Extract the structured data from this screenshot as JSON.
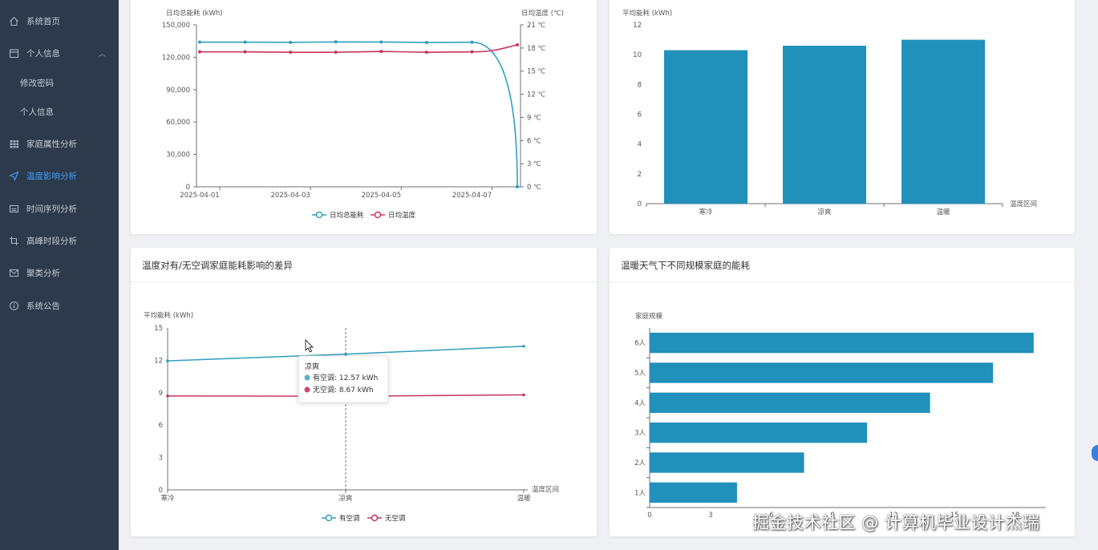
{
  "sidebar": {
    "items": [
      {
        "label": "系统首页",
        "icon": "home-icon"
      },
      {
        "label": "个人信息",
        "icon": "calendar-icon"
      },
      {
        "label": "修改密码"
      },
      {
        "label": "个人信息"
      },
      {
        "label": "家庭属性分析",
        "icon": "grid-icon"
      },
      {
        "label": "温度影响分析",
        "icon": "send-icon"
      },
      {
        "label": "时间序列分析",
        "icon": "keyboard-icon"
      },
      {
        "label": "高峰时段分析",
        "icon": "crop-icon"
      },
      {
        "label": "聚类分析",
        "icon": "mail-icon"
      },
      {
        "label": "系统公告",
        "icon": "info-icon"
      }
    ],
    "active": "温度影响分析"
  },
  "chart_data": [
    {
      "type": "line",
      "x": [
        "2025-04-01",
        "2025-04-02",
        "2025-04-03",
        "2025-04-04",
        "2025-04-05",
        "2025-04-06",
        "2025-04-07",
        "2025-04-08"
      ],
      "xticks": [
        "2025-04-01",
        "2025-04-03",
        "2025-04-05",
        "2025-04-07"
      ],
      "series": [
        {
          "name": "日均总能耗",
          "axis": "left",
          "color": "#2f9fbd",
          "values": [
            134000,
            134000,
            133800,
            134200,
            134100,
            133700,
            133900,
            0
          ]
        },
        {
          "name": "日均温度",
          "axis": "right",
          "color": "#c7365f",
          "values": [
            17.5,
            17.5,
            17.45,
            17.45,
            17.55,
            17.45,
            17.5,
            18.4
          ]
        }
      ],
      "ylabel_left": "日均总能耗 (kWh)",
      "ylabel_right": "日均温度 (℃)",
      "yticks_left": [
        "0",
        "30,000",
        "60,000",
        "90,000",
        "120,000",
        "150,000"
      ],
      "yticks_right": [
        "0 ℃",
        "3 ℃",
        "6 ℃",
        "9 ℃",
        "12 ℃",
        "15 ℃",
        "18 ℃",
        "21 ℃"
      ],
      "ylim_left": [
        0,
        150000
      ],
      "ylim_right": [
        0,
        21
      ],
      "legend_position": "bottom"
    },
    {
      "type": "bar",
      "categories": [
        "寒冷",
        "凉爽",
        "温暖"
      ],
      "values": [
        10.3,
        10.6,
        11.0
      ],
      "color": "#2190bb",
      "ylabel": "平均能耗 (kWh)",
      "xlabel": "温度区间",
      "yticks": [
        "0",
        "2",
        "4",
        "6",
        "8",
        "10",
        "12"
      ],
      "ylim": [
        0,
        12
      ]
    },
    {
      "type": "line",
      "title": "温度对有/无空调家庭能耗影响的差异",
      "categories": [
        "寒冷",
        "凉爽",
        "温暖"
      ],
      "series": [
        {
          "name": "有空调",
          "color": "#2f9fbd",
          "values": [
            11.95,
            12.57,
            13.3
          ]
        },
        {
          "name": "无空调",
          "color": "#c7365f",
          "values": [
            8.7,
            8.67,
            8.8
          ]
        }
      ],
      "ylabel": "平均能耗 (kWh)",
      "xlabel": "温度区间",
      "yticks": [
        "0",
        "3",
        "6",
        "9",
        "12",
        "15"
      ],
      "ylim": [
        0,
        15
      ],
      "legend_position": "bottom",
      "tooltip": {
        "title": "凉爽",
        "rows": [
          {
            "label": "有空调: 12.57 kWh",
            "color": "#5ab1d0"
          },
          {
            "label": "无空调: 8.67 kWh",
            "color": "#d04a6a"
          }
        ]
      }
    },
    {
      "type": "bar",
      "orientation": "horizontal",
      "title": "温暖天气下不同规模家庭的能耗",
      "categories": [
        "1人",
        "2人",
        "3人",
        "4人",
        "5人",
        "6人"
      ],
      "values": [
        4.3,
        7.6,
        10.7,
        13.8,
        16.9,
        18.9
      ],
      "color": "#2190bb",
      "ylabel": "家庭规模",
      "xticks": [
        "0",
        "3",
        "6",
        "9",
        "12",
        "15",
        "18"
      ],
      "xlim": [
        0,
        19.5
      ]
    }
  ],
  "watermark": "掘金技术社区 @ 计算机毕业设计杰瑞"
}
